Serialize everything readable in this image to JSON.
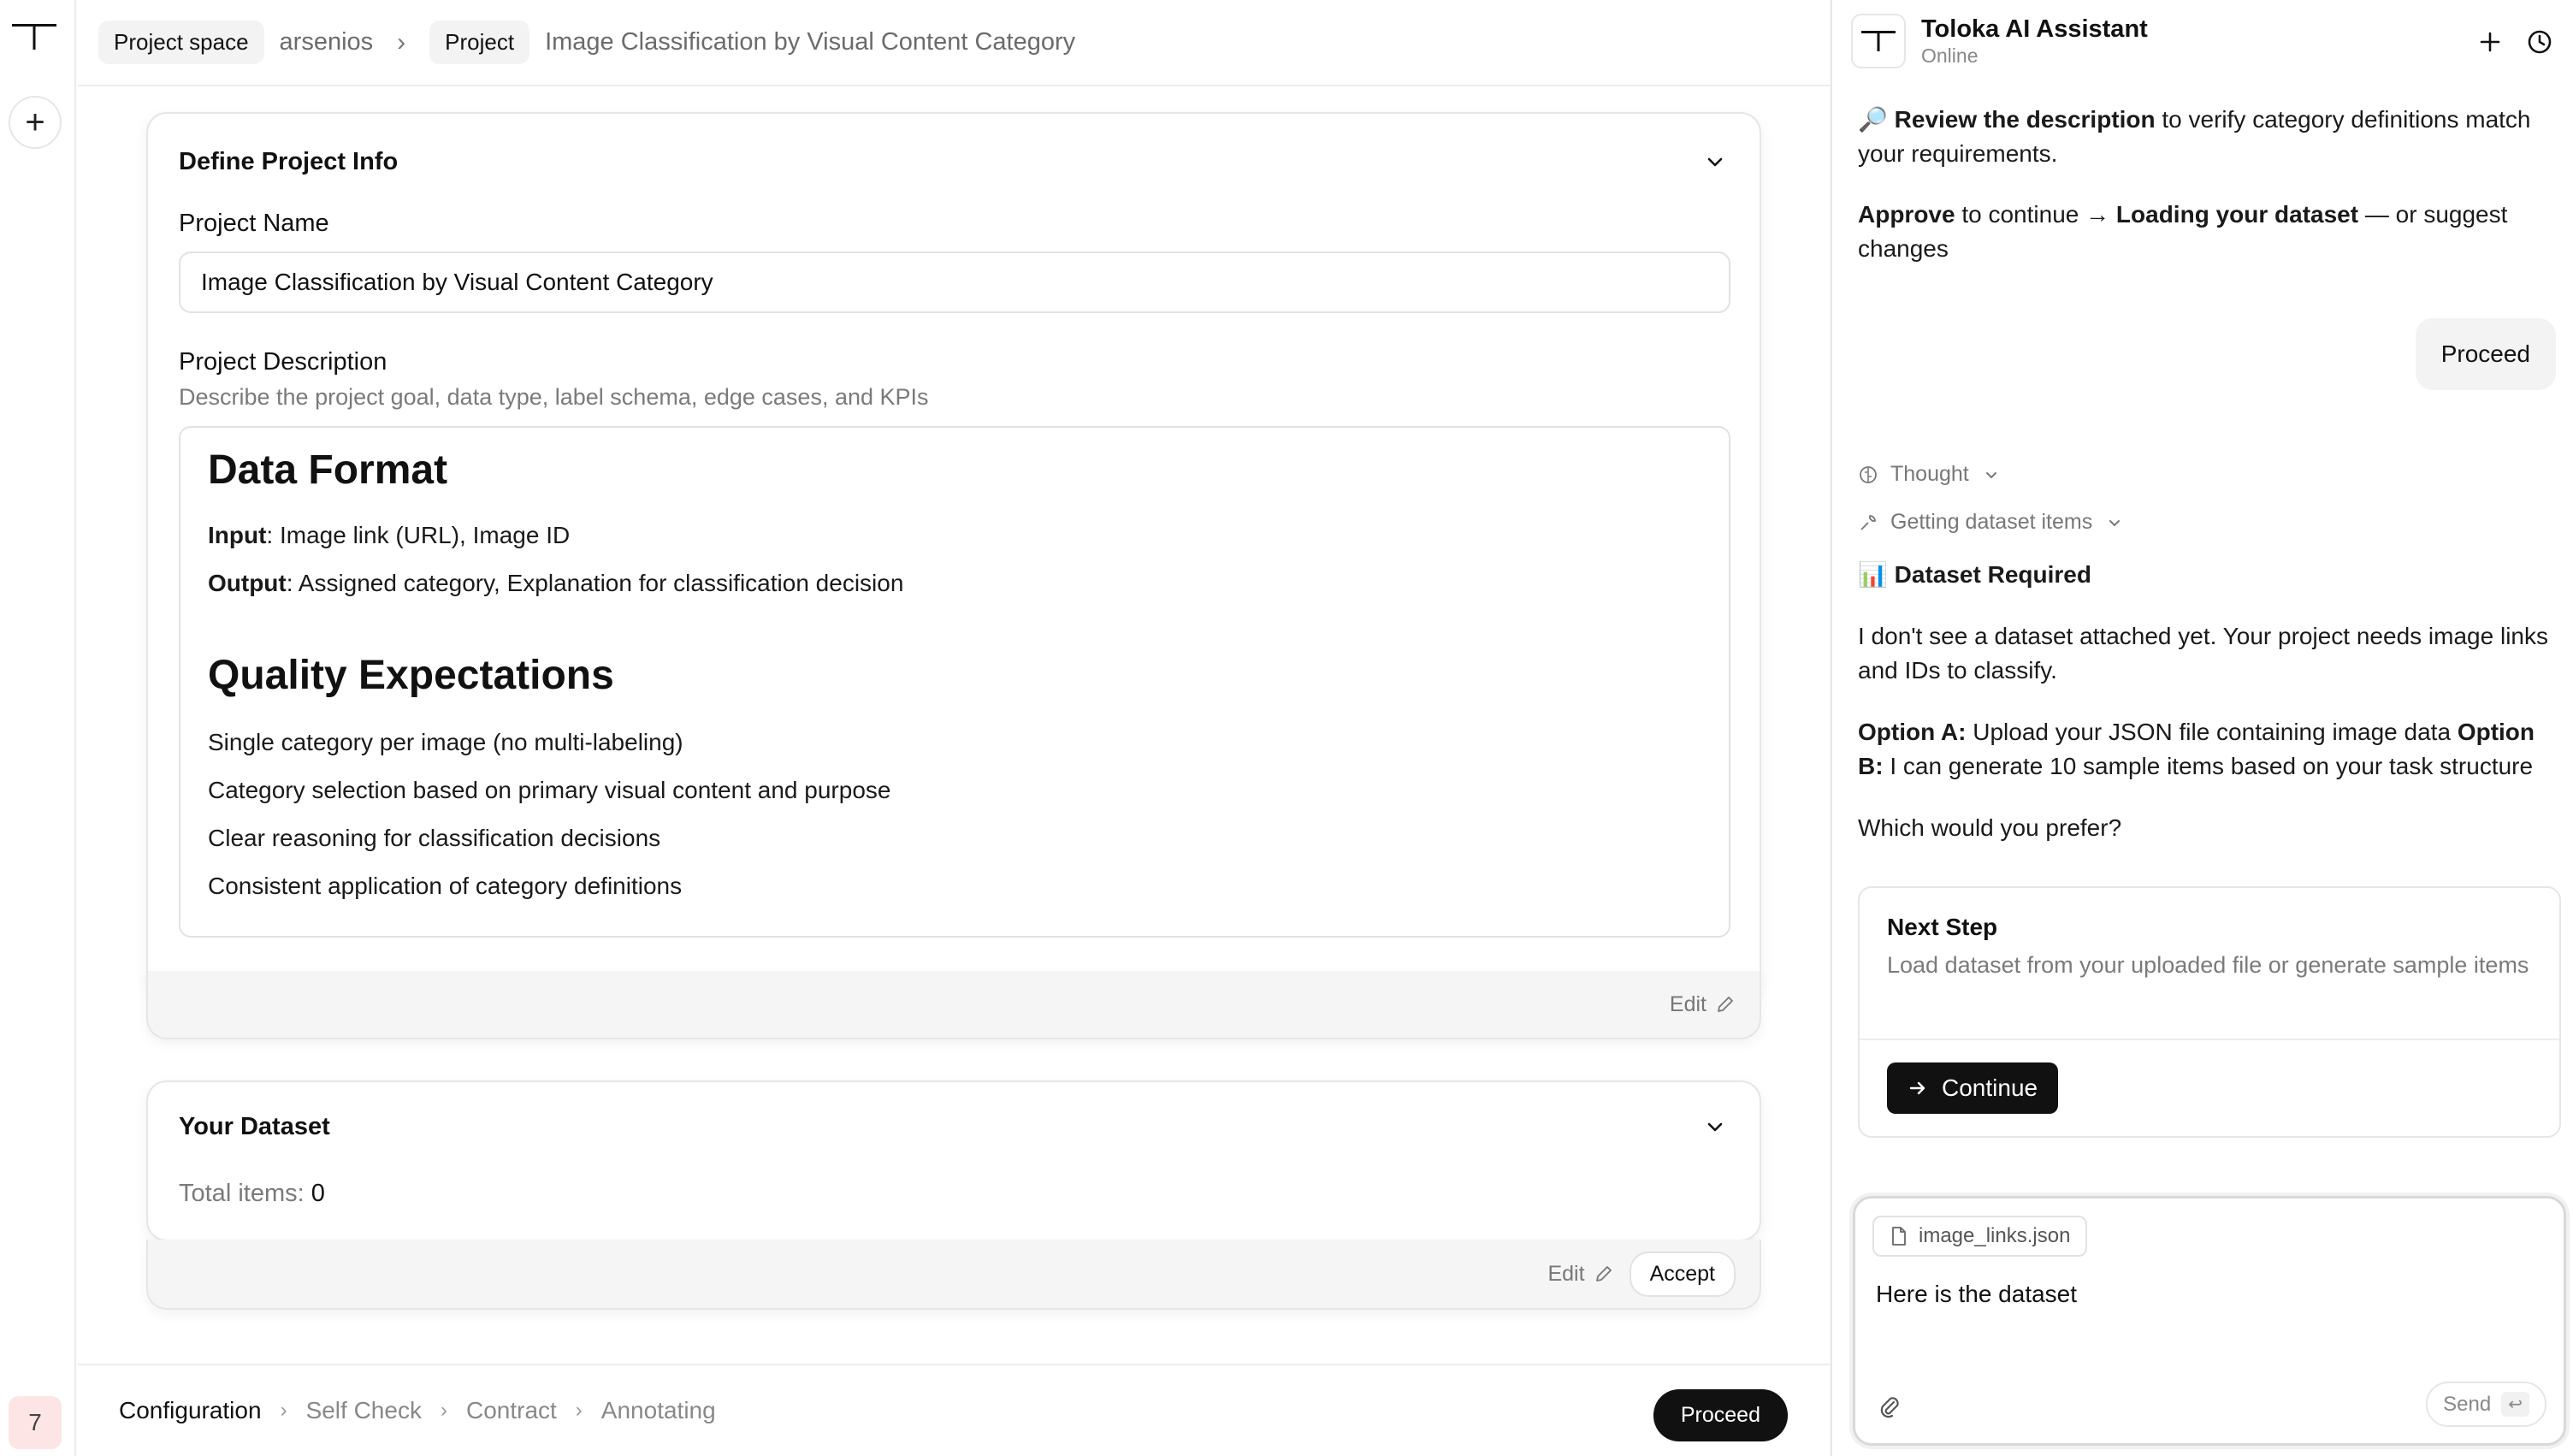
{
  "app": {
    "rail_badge": "7"
  },
  "breadcrumb": {
    "chip1": "Project space",
    "user": "arsenios",
    "chip2": "Project",
    "project_title": "Image Classification by Visual Content Category"
  },
  "project_info": {
    "title": "Define Project Info",
    "name_label": "Project Name",
    "name_value": "Image Classification by Visual Content Category",
    "desc_label": "Project Description",
    "desc_hint": "Describe the project goal, data type, label schema, edge cases, and KPIs",
    "data_format_heading": "Data Format",
    "input_label": "Input",
    "input_value": ": Image link (URL), Image ID",
    "output_label": "Output",
    "output_value": ": Assigned category, Explanation for classification decision",
    "quality_heading": "Quality Expectations",
    "quality_items": [
      "Single category per image (no multi-labeling)",
      "Category selection based on primary visual content and purpose",
      "Clear reasoning for classification decisions",
      "Consistent application of category definitions"
    ],
    "edit_label": "Edit"
  },
  "dataset": {
    "title": "Your Dataset",
    "total_label": "Total items:",
    "total_value": "0",
    "edit_label": "Edit",
    "accept_label": "Accept"
  },
  "stepper": {
    "steps": [
      "Configuration",
      "Self Check",
      "Contract",
      "Annotating"
    ],
    "active": "Configuration",
    "proceed_label": "Proceed"
  },
  "assistant": {
    "name": "Toloka AI Assistant",
    "status": "Online",
    "msg1_emoji": "🔎",
    "msg1_bold": "Review the description",
    "msg1_rest": " to verify category definitions match your requirements.",
    "msg2_bold1": "Approve",
    "msg2_mid": " to continue → ",
    "msg2_bold2": "Loading your dataset",
    "msg2_rest": " — or suggest changes",
    "user_bubble": "Proceed",
    "thought_label": "Thought",
    "tool_label": "Getting dataset items",
    "dataset_emoji": "📊",
    "dataset_heading": "Dataset Required",
    "msg3": "I don't see a dataset attached yet. Your project needs image links and IDs to classify.",
    "optA_bold": "Option A:",
    "optA_text": " Upload your JSON file containing image data ",
    "optB_bold": "Option B:",
    "optB_text": " I can generate 10 sample items based on your task structure",
    "question": "Which would you prefer?",
    "next_step_title": "Next Step",
    "next_step_desc": "Load dataset from your uploaded file or generate sample items",
    "continue_label": "Continue",
    "attachment_name": "image_links.json",
    "composer_text": "Here is the dataset",
    "send_label": "Send"
  }
}
